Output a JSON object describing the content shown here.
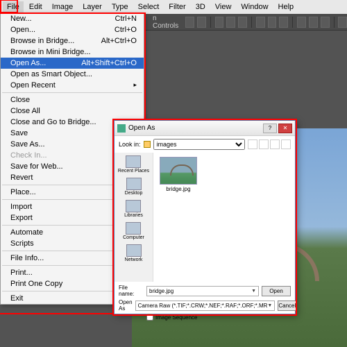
{
  "menubar": [
    "File",
    "Edit",
    "Image",
    "Layer",
    "Type",
    "Select",
    "Filter",
    "3D",
    "View",
    "Window",
    "Help"
  ],
  "toolbar_text": "n Controls",
  "dropdown": [
    {
      "label": "New...",
      "sc": "Ctrl+N"
    },
    {
      "label": "Open...",
      "sc": "Ctrl+O"
    },
    {
      "label": "Browse in Bridge...",
      "sc": "Alt+Ctrl+O"
    },
    {
      "label": "Browse in Mini Bridge..."
    },
    {
      "label": "Open As...",
      "sc": "Alt+Shift+Ctrl+O",
      "hl": true
    },
    {
      "label": "Open as Smart Object..."
    },
    {
      "label": "Open Recent",
      "sub": true
    },
    {
      "sep": true
    },
    {
      "label": "Close"
    },
    {
      "label": "Close All"
    },
    {
      "label": "Close and Go to Bridge..."
    },
    {
      "label": "Save"
    },
    {
      "label": "Save As..."
    },
    {
      "label": "Check In...",
      "dim": true
    },
    {
      "label": "Save for Web..."
    },
    {
      "label": "Revert"
    },
    {
      "sep": true
    },
    {
      "label": "Place..."
    },
    {
      "sep": true
    },
    {
      "label": "Import"
    },
    {
      "label": "Export"
    },
    {
      "sep": true
    },
    {
      "label": "Automate"
    },
    {
      "label": "Scripts"
    },
    {
      "sep": true
    },
    {
      "label": "File Info..."
    },
    {
      "sep": true
    },
    {
      "label": "Print..."
    },
    {
      "label": "Print One Copy"
    },
    {
      "sep": true
    },
    {
      "label": "Exit"
    }
  ],
  "dialog": {
    "title": "Open As",
    "lookin_label": "Look in:",
    "lookin_value": "images",
    "places": [
      "Recent Places",
      "Desktop",
      "Libraries",
      "Computer",
      "Network"
    ],
    "file": "bridge.jpg",
    "filename_label": "File name:",
    "filename_value": "bridge.jpg",
    "openas_label": "Open As",
    "openas_value": "Camera Raw (*.TIF;*.CRW;*.NEF;*.RAF;*.ORF;*.MR",
    "open_btn": "Open",
    "cancel_btn": "Cancel",
    "seq_label": "Image Sequence"
  }
}
